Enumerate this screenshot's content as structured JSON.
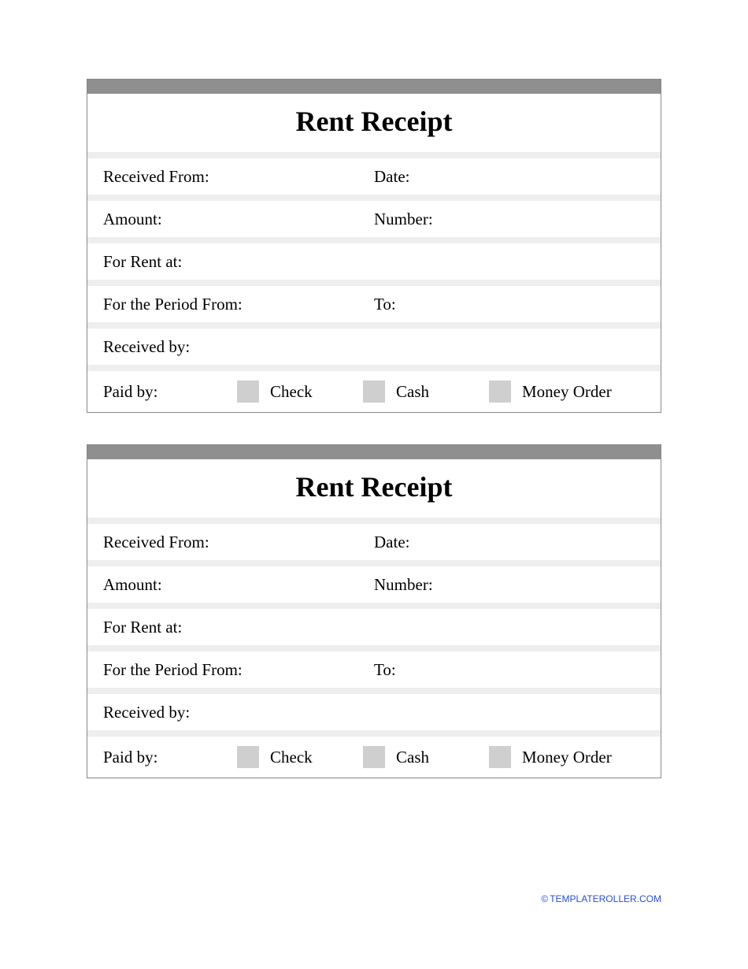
{
  "receipt": {
    "title": "Rent Receipt",
    "labels": {
      "received_from": "Received From:",
      "date": "Date:",
      "amount": "Amount:",
      "number": "Number:",
      "for_rent_at": "For Rent at:",
      "period_from": "For the Period From:",
      "period_to": "To:",
      "received_by": "Received by:",
      "paid_by": "Paid by:"
    },
    "payment_options": {
      "check": "Check",
      "cash": "Cash",
      "money_order": "Money Order"
    }
  },
  "footer": {
    "copyright_symbol": "©",
    "site": "TEMPLATEROLLER.COM"
  }
}
